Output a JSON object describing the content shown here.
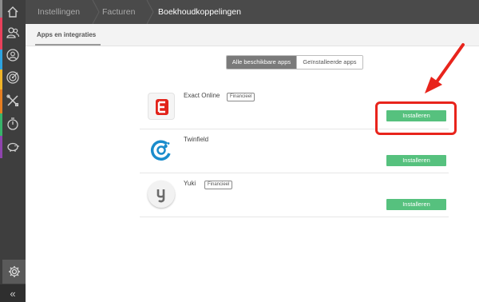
{
  "breadcrumb": {
    "items": [
      "Instellingen",
      "Facturen",
      "Boekhoudkoppelingen"
    ]
  },
  "subheader": {
    "title": "Apps en integraties"
  },
  "tabs": [
    {
      "label": "Alle beschikbare apps",
      "active": true
    },
    {
      "label": "Geïnstalleerde apps",
      "active": false
    }
  ],
  "apps": [
    {
      "name": "Exact Online",
      "badge": "Financieel",
      "action": "Installeren",
      "logo_color": "#e2231a",
      "logo_letter": "E"
    },
    {
      "name": "Twinfield",
      "badge": "",
      "action": "Installeren",
      "logo_color": "#1a8ccc"
    },
    {
      "name": "Yuki",
      "badge": "Financieel",
      "action": "Installeren",
      "logo_color": "#6a6a6a",
      "logo_letter": "y"
    }
  ],
  "sidebar": {
    "icons": [
      "home-icon",
      "users-icon",
      "user-circle-icon",
      "target-icon",
      "tools-icon",
      "timer-icon",
      "piggy-bank-icon",
      "settings-icon"
    ],
    "collapse_label": "«"
  },
  "colors": {
    "accent_green": "#56c17e",
    "annotation_red": "#e8241c",
    "topbar": "#4a4a4a",
    "sidebar": "#3e3e3e"
  }
}
